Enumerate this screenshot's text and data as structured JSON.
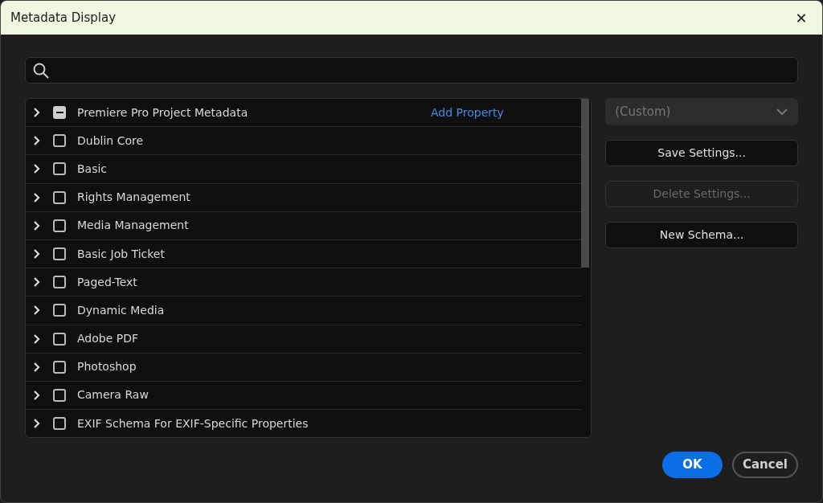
{
  "window": {
    "title": "Metadata Display",
    "close": "✕"
  },
  "schemas": [
    {
      "label": "Premiere Pro Project Metadata",
      "expanded": false,
      "checked": false,
      "indeterminate": true,
      "action": "Add Property"
    },
    {
      "label": "Dublin Core",
      "expanded": false,
      "checked": false,
      "indeterminate": false
    },
    {
      "label": "Basic",
      "expanded": false,
      "checked": false,
      "indeterminate": false
    },
    {
      "label": "Rights Management",
      "expanded": false,
      "checked": false,
      "indeterminate": false
    },
    {
      "label": "Media Management",
      "expanded": false,
      "checked": false,
      "indeterminate": false
    },
    {
      "label": "Basic Job Ticket",
      "expanded": false,
      "checked": false,
      "indeterminate": false
    },
    {
      "label": "Paged-Text",
      "expanded": false,
      "checked": false,
      "indeterminate": false
    },
    {
      "label": "Dynamic Media",
      "expanded": false,
      "checked": false,
      "indeterminate": false
    },
    {
      "label": "Adobe PDF",
      "expanded": false,
      "checked": false,
      "indeterminate": false
    },
    {
      "label": "Photoshop",
      "expanded": false,
      "checked": false,
      "indeterminate": false
    },
    {
      "label": "Camera Raw",
      "expanded": false,
      "checked": false,
      "indeterminate": false
    },
    {
      "label": "EXIF Schema For EXIF-Specific Properties",
      "expanded": false,
      "checked": false,
      "indeterminate": false
    }
  ],
  "preset": {
    "value": "(Custom)",
    "disabled": true
  },
  "side_buttons": [
    {
      "label": "Save Settings...",
      "disabled": false
    },
    {
      "label": "Delete Settings...",
      "disabled": true
    },
    {
      "label": "New Schema...",
      "disabled": false
    }
  ],
  "buttons": [
    {
      "label": "OK",
      "kind": "primary"
    },
    {
      "label": "Cancel",
      "kind": "secondary"
    }
  ]
}
